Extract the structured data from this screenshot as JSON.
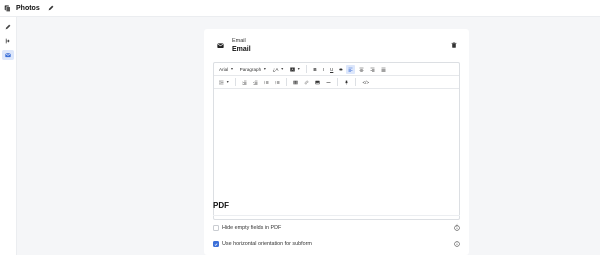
{
  "topbar": {
    "title": "Photos"
  },
  "field": {
    "type_label": "Email",
    "name": "Email"
  },
  "toolbar": {
    "font": "Arial",
    "block": "Paragraph",
    "size": "¿A",
    "bold": "B",
    "italic": "I",
    "underline": "U",
    "strike": "S",
    "code": "</>"
  },
  "pdf": {
    "title": "PDF",
    "options": [
      {
        "label": "Hide empty fields in PDF",
        "checked": false
      },
      {
        "label": "Use horizontal orientation for subform",
        "checked": true
      }
    ]
  },
  "colors": {
    "accent": "#3b6fd8",
    "active_bg": "#dde7fb"
  }
}
